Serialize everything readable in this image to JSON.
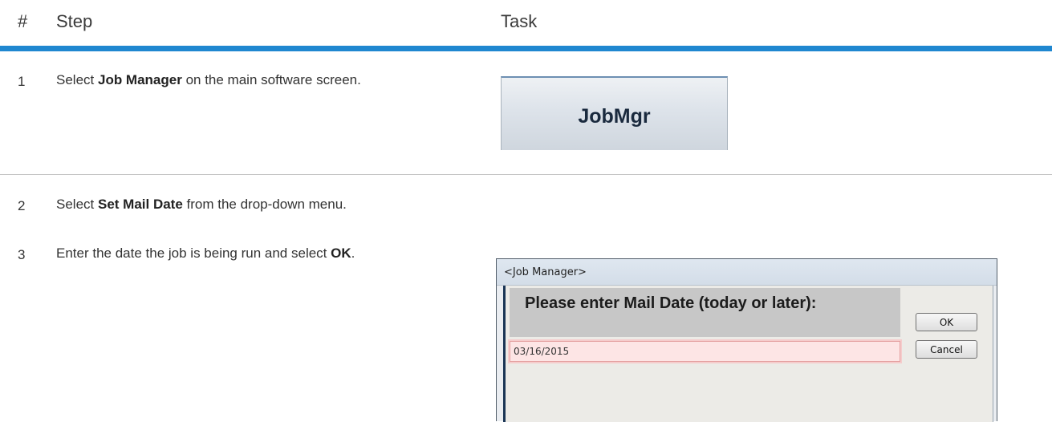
{
  "table": {
    "headers": {
      "number": "#",
      "step": "Step",
      "task": "Task"
    },
    "rows": [
      {
        "number": "1",
        "step_pre": "Select ",
        "step_bold": "Job Manager",
        "step_post": " on the main software screen.",
        "task_button_label": "JobMgr"
      },
      {
        "number": "2",
        "step_pre": "Select ",
        "step_bold": "Set Mail Date",
        "step_post": " from the drop-down menu."
      },
      {
        "number": "3",
        "step_pre": "Enter the date the job is being run and select ",
        "step_bold": "OK",
        "step_post": "."
      }
    ]
  },
  "dialog": {
    "title": "<Job Manager>",
    "prompt": "Please enter Mail Date (today or later):",
    "date_value": "03/16/2015",
    "ok_label": "OK",
    "cancel_label": "Cancel"
  },
  "colors": {
    "header_rule": "#1f87d0",
    "row_rule": "#c6c6c6",
    "input_bg": "#fde5e5"
  }
}
